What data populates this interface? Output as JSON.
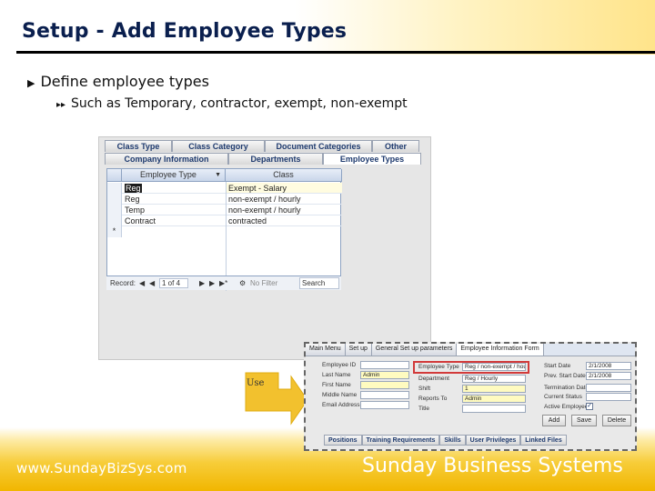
{
  "slide": {
    "title": "Setup - Add Employee Types",
    "bullet_1": "Define employee types",
    "bullet_2": "Such as Temporary, contractor, exempt, non-exempt",
    "use_label": "Use",
    "footer_url": "www.SundayBizSys.com",
    "footer_brand": "Sunday Business Systems"
  },
  "setup_form": {
    "tabs_row1": [
      "Class Type",
      "Class Category",
      "Document Categories",
      "Other"
    ],
    "tabs_row2": [
      "Company Information",
      "Departments",
      "Employee Types"
    ],
    "active_tab": "Employee Types",
    "columns": [
      "Employee Type",
      "Class"
    ],
    "rows": [
      {
        "type": "Reg",
        "class": "Exempt - Salary"
      },
      {
        "type": "Reg",
        "class": "non-exempt / hourly"
      },
      {
        "type": "Temp",
        "class": "non-exempt / hourly"
      },
      {
        "type": "Contract",
        "class": "contracted"
      }
    ],
    "new_row_marker": "*",
    "nav": {
      "record_label": "Record:",
      "position": "1 of 4",
      "filter": "No Filter",
      "search": "Search"
    }
  },
  "employee_form": {
    "tabs": [
      "Main Menu",
      "Set up",
      "General Set up parameters",
      "Employee Information Form"
    ],
    "left_labels": [
      "Employee ID",
      "Last Name",
      "First Name",
      "Middle Name",
      "Email Address"
    ],
    "left_values": [
      "",
      "Admin",
      "",
      "",
      ""
    ],
    "mid_labels": [
      "Employee Type",
      "Department",
      "Shift",
      "Reports To",
      "Title"
    ],
    "mid_values": [
      "Reg / non-exempt / hourly",
      "Reg / Hourly",
      "1",
      "Admin",
      ""
    ],
    "right_labels": [
      "Start Date",
      "Prev. Start Date",
      "Termination Date",
      "Current Status",
      "Active Employee"
    ],
    "right_values": [
      "2/1/2008",
      "2/1/2008",
      "",
      "",
      ""
    ],
    "buttons": [
      "Add",
      "Save",
      "Delete"
    ],
    "bottom_tabs": [
      "Positions",
      "Training Requirements",
      "Skills",
      "User Privileges",
      "Linked Files"
    ]
  },
  "colors": {
    "title_text": "#0a1f4e",
    "footer_gold": "#f1b600",
    "arrow_gold": "#f2c12e",
    "highlight_red": "#d23a3a"
  }
}
